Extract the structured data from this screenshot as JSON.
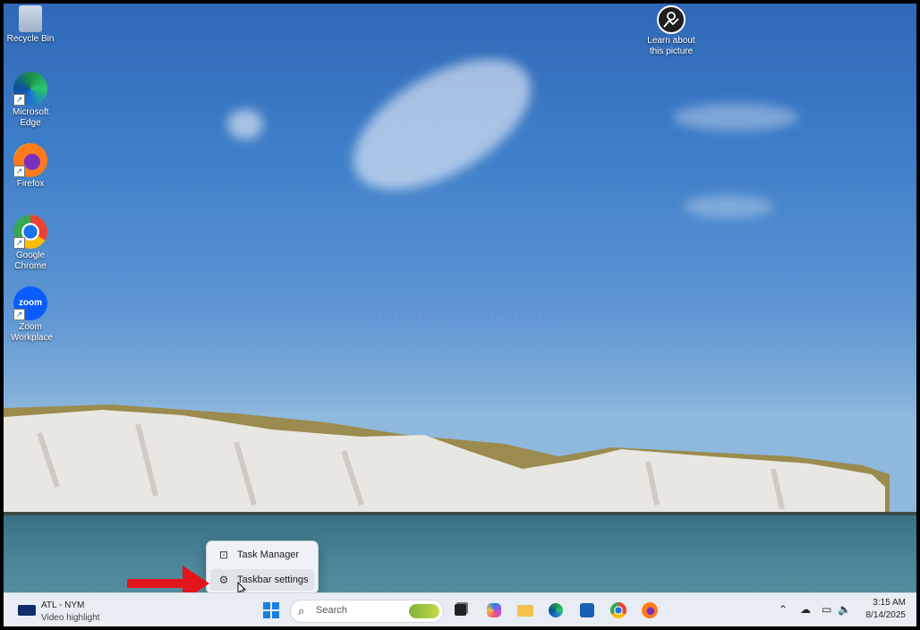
{
  "desktop": {
    "watermark": "IT Pros HUB",
    "icons": [
      {
        "label": "Recycle Bin"
      },
      {
        "label": "Microsoft Edge"
      },
      {
        "label": "Firefox"
      },
      {
        "label": "Google Chrome"
      },
      {
        "label": "Zoom Workplace"
      }
    ],
    "learn_about": "Learn about this picture"
  },
  "context_menu": {
    "items": [
      {
        "label": "Task Manager",
        "icon": "task-manager-icon"
      },
      {
        "label": "Taskbar settings",
        "icon": "gear-icon"
      }
    ]
  },
  "taskbar": {
    "widget": {
      "line1": "ATL - NYM",
      "line2": "Video highlight"
    },
    "search_placeholder": "Search",
    "pinned": [
      "start",
      "task-view",
      "copilot",
      "file-explorer",
      "edge",
      "store",
      "chrome",
      "firefox"
    ],
    "clock": {
      "time": "3:15 AM",
      "date": "8/14/2025"
    }
  },
  "colors": {
    "accent_arrow": "#e4141b",
    "taskbar_bg": "#e8edf3"
  }
}
